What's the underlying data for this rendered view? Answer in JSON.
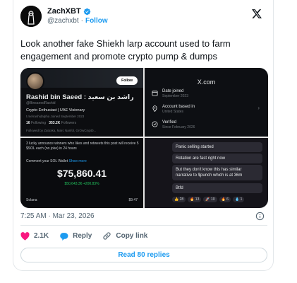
{
  "author": {
    "name": "ZachXBT",
    "handle": "@zachxbt",
    "follow_label": "Follow",
    "separator": "·"
  },
  "icons": {
    "verified": "verified-badge-icon",
    "platform": "x-logo-icon",
    "info": "info-icon",
    "like": "heart-icon",
    "reply": "reply-icon",
    "copy": "link-icon"
  },
  "colors": {
    "accent": "#1d9bf0",
    "like": "#f91880",
    "muted": "#536471",
    "text": "#0f1419"
  },
  "tweet": {
    "text": "Look another fake Shiekh larp account used to farm engagement and promote crypto pump & dumps",
    "timestamp": "7:25 AM · Mar 23, 2026"
  },
  "media": {
    "profile_card": {
      "follow_label": "Follow",
      "display_name": "Rashid bin Saeed : راشد بن سعيد",
      "handle": "@BinsaeedRashid",
      "bio": "Crypto Enthusiast | UAE Visionary",
      "meta": "t.me/rashidalpha   Joined September 2023",
      "following": "16",
      "following_label": "Following",
      "followers": "353.2K",
      "followers_label": "Followers",
      "followed_by": "Followed by Zatoxka, Marc Nanfol, GrOwCrypt0..."
    },
    "about_panel": {
      "site": "X.com",
      "rows": [
        {
          "label": "Date joined",
          "sub": "September 2023"
        },
        {
          "label": "Account based in",
          "sub": "United States"
        },
        {
          "label": "Verified",
          "sub": "Since February 2026"
        }
      ]
    },
    "giveaway_post": {
      "line1": "3 lucky announce winners who likes and retweets this post will receive 5 $SOL each (no joke) in 24 hours",
      "line2": "Comment your SOL Wallet",
      "show_more": "Show more",
      "balance": "$75,860.41",
      "change": "$50,643.36  +200.83%",
      "token_name": "Solana",
      "token_value": "$9.47"
    },
    "chat": {
      "messages": [
        "Panic selling started",
        "Rotation are fast right now",
        "But they don't know this has similar narrative to $punch which is at 36m",
        "Btfd"
      ],
      "reactions": [
        "👍 28",
        "🔥 13",
        "🚀 10",
        "🔥 6",
        "💧 1"
      ]
    }
  },
  "actions": {
    "likes": "2.1K",
    "reply_label": "Reply",
    "copy_label": "Copy link"
  },
  "read_replies_label": "Read 80 replies"
}
